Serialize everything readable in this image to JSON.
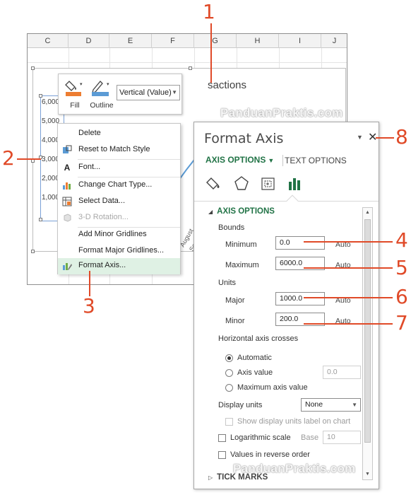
{
  "sheet": {
    "columns": [
      "C",
      "D",
      "E",
      "F",
      "G",
      "H",
      "I",
      "J"
    ],
    "chart_title_partial": "sactions",
    "y_ticks": [
      "6,000",
      "5,000",
      "4,000",
      "3,000",
      "2,000",
      "1,000"
    ],
    "x_labels": [
      "August",
      "Sep"
    ]
  },
  "mini_toolbar": {
    "fill_label": "Fill",
    "outline_label": "Outline",
    "element_select": "Vertical (Value)"
  },
  "context_menu": {
    "items": [
      {
        "label": "Delete",
        "icon": "none",
        "enabled": true
      },
      {
        "label": "Reset to Match Style",
        "icon": "reset-style-icon",
        "enabled": true
      },
      {
        "label": "Font...",
        "icon": "font-icon",
        "enabled": true
      },
      {
        "label": "Change Chart Type...",
        "icon": "chart-type-icon",
        "enabled": true
      },
      {
        "label": "Select Data...",
        "icon": "select-data-icon",
        "enabled": true
      },
      {
        "label": "3-D Rotation...",
        "icon": "3d-rotation-icon",
        "enabled": false
      },
      {
        "label": "Add Minor Gridlines",
        "icon": "none",
        "enabled": true
      },
      {
        "label": "Format Major Gridlines...",
        "icon": "none",
        "enabled": true
      },
      {
        "label": "Format Axis...",
        "icon": "format-axis-icon",
        "enabled": true,
        "highlighted": true
      }
    ]
  },
  "format_pane": {
    "title": "Format Axis",
    "tab_axis_options": "AXIS OPTIONS",
    "tab_text_options": "TEXT OPTIONS",
    "section_header": "AXIS OPTIONS",
    "bounds_label": "Bounds",
    "minimum_label": "Minimum",
    "minimum_value": "0.0",
    "maximum_label": "Maximum",
    "maximum_value": "6000.0",
    "units_label": "Units",
    "major_label": "Major",
    "major_value": "1000.0",
    "minor_label": "Minor",
    "minor_value": "200.0",
    "auto_label": "Auto",
    "crosses_label": "Horizontal axis crosses",
    "crosses_automatic": "Automatic",
    "crosses_axis_value": "Axis value",
    "crosses_axis_value_input": "0.0",
    "crosses_maximum": "Maximum axis value",
    "crosses_selected": "Automatic",
    "display_units_label": "Display units",
    "display_units_value": "None",
    "show_units_label": "Show display units label on chart",
    "log_scale_label": "Logarithmic scale",
    "base_label": "Base",
    "base_value": "10",
    "reverse_label": "Values in reverse order",
    "next_section": "TICK MARKS"
  },
  "watermark_text": "PanduanPraktis.com",
  "callouts": [
    "1",
    "2",
    "3",
    "4",
    "5",
    "6",
    "7",
    "8"
  ],
  "colors": {
    "accent_green": "#217346",
    "callout_red": "#e04a28",
    "menu_highlight": "#dff1e4",
    "fill_orange": "#ed7d31",
    "outline_blue": "#5b9bd5"
  }
}
